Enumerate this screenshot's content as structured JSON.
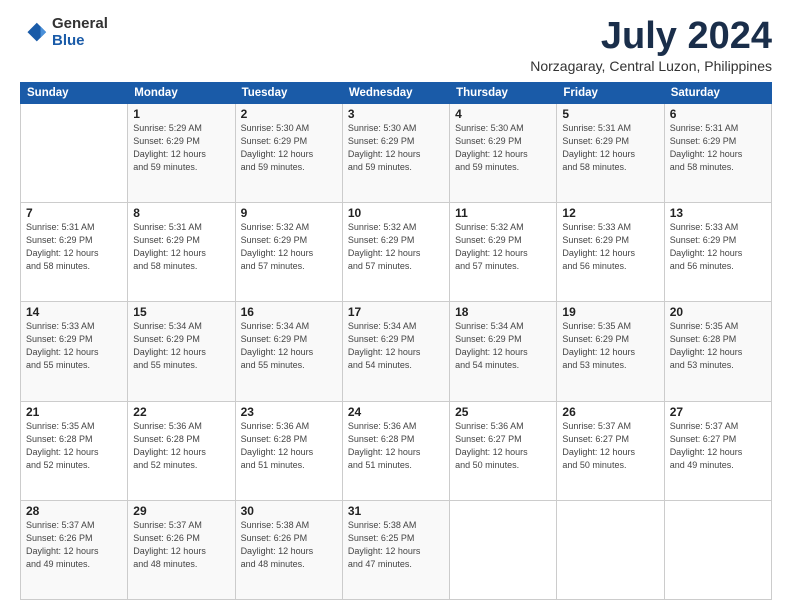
{
  "logo": {
    "general": "General",
    "blue": "Blue"
  },
  "title": "July 2024",
  "location": "Norzagaray, Central Luzon, Philippines",
  "headers": [
    "Sunday",
    "Monday",
    "Tuesday",
    "Wednesday",
    "Thursday",
    "Friday",
    "Saturday"
  ],
  "weeks": [
    [
      {
        "day": "",
        "info": ""
      },
      {
        "day": "1",
        "info": "Sunrise: 5:29 AM\nSunset: 6:29 PM\nDaylight: 12 hours\nand 59 minutes."
      },
      {
        "day": "2",
        "info": "Sunrise: 5:30 AM\nSunset: 6:29 PM\nDaylight: 12 hours\nand 59 minutes."
      },
      {
        "day": "3",
        "info": "Sunrise: 5:30 AM\nSunset: 6:29 PM\nDaylight: 12 hours\nand 59 minutes."
      },
      {
        "day": "4",
        "info": "Sunrise: 5:30 AM\nSunset: 6:29 PM\nDaylight: 12 hours\nand 59 minutes."
      },
      {
        "day": "5",
        "info": "Sunrise: 5:31 AM\nSunset: 6:29 PM\nDaylight: 12 hours\nand 58 minutes."
      },
      {
        "day": "6",
        "info": "Sunrise: 5:31 AM\nSunset: 6:29 PM\nDaylight: 12 hours\nand 58 minutes."
      }
    ],
    [
      {
        "day": "7",
        "info": "Sunrise: 5:31 AM\nSunset: 6:29 PM\nDaylight: 12 hours\nand 58 minutes."
      },
      {
        "day": "8",
        "info": "Sunrise: 5:31 AM\nSunset: 6:29 PM\nDaylight: 12 hours\nand 58 minutes."
      },
      {
        "day": "9",
        "info": "Sunrise: 5:32 AM\nSunset: 6:29 PM\nDaylight: 12 hours\nand 57 minutes."
      },
      {
        "day": "10",
        "info": "Sunrise: 5:32 AM\nSunset: 6:29 PM\nDaylight: 12 hours\nand 57 minutes."
      },
      {
        "day": "11",
        "info": "Sunrise: 5:32 AM\nSunset: 6:29 PM\nDaylight: 12 hours\nand 57 minutes."
      },
      {
        "day": "12",
        "info": "Sunrise: 5:33 AM\nSunset: 6:29 PM\nDaylight: 12 hours\nand 56 minutes."
      },
      {
        "day": "13",
        "info": "Sunrise: 5:33 AM\nSunset: 6:29 PM\nDaylight: 12 hours\nand 56 minutes."
      }
    ],
    [
      {
        "day": "14",
        "info": "Sunrise: 5:33 AM\nSunset: 6:29 PM\nDaylight: 12 hours\nand 55 minutes."
      },
      {
        "day": "15",
        "info": "Sunrise: 5:34 AM\nSunset: 6:29 PM\nDaylight: 12 hours\nand 55 minutes."
      },
      {
        "day": "16",
        "info": "Sunrise: 5:34 AM\nSunset: 6:29 PM\nDaylight: 12 hours\nand 55 minutes."
      },
      {
        "day": "17",
        "info": "Sunrise: 5:34 AM\nSunset: 6:29 PM\nDaylight: 12 hours\nand 54 minutes."
      },
      {
        "day": "18",
        "info": "Sunrise: 5:34 AM\nSunset: 6:29 PM\nDaylight: 12 hours\nand 54 minutes."
      },
      {
        "day": "19",
        "info": "Sunrise: 5:35 AM\nSunset: 6:29 PM\nDaylight: 12 hours\nand 53 minutes."
      },
      {
        "day": "20",
        "info": "Sunrise: 5:35 AM\nSunset: 6:28 PM\nDaylight: 12 hours\nand 53 minutes."
      }
    ],
    [
      {
        "day": "21",
        "info": "Sunrise: 5:35 AM\nSunset: 6:28 PM\nDaylight: 12 hours\nand 52 minutes."
      },
      {
        "day": "22",
        "info": "Sunrise: 5:36 AM\nSunset: 6:28 PM\nDaylight: 12 hours\nand 52 minutes."
      },
      {
        "day": "23",
        "info": "Sunrise: 5:36 AM\nSunset: 6:28 PM\nDaylight: 12 hours\nand 51 minutes."
      },
      {
        "day": "24",
        "info": "Sunrise: 5:36 AM\nSunset: 6:28 PM\nDaylight: 12 hours\nand 51 minutes."
      },
      {
        "day": "25",
        "info": "Sunrise: 5:36 AM\nSunset: 6:27 PM\nDaylight: 12 hours\nand 50 minutes."
      },
      {
        "day": "26",
        "info": "Sunrise: 5:37 AM\nSunset: 6:27 PM\nDaylight: 12 hours\nand 50 minutes."
      },
      {
        "day": "27",
        "info": "Sunrise: 5:37 AM\nSunset: 6:27 PM\nDaylight: 12 hours\nand 49 minutes."
      }
    ],
    [
      {
        "day": "28",
        "info": "Sunrise: 5:37 AM\nSunset: 6:26 PM\nDaylight: 12 hours\nand 49 minutes."
      },
      {
        "day": "29",
        "info": "Sunrise: 5:37 AM\nSunset: 6:26 PM\nDaylight: 12 hours\nand 48 minutes."
      },
      {
        "day": "30",
        "info": "Sunrise: 5:38 AM\nSunset: 6:26 PM\nDaylight: 12 hours\nand 48 minutes."
      },
      {
        "day": "31",
        "info": "Sunrise: 5:38 AM\nSunset: 6:25 PM\nDaylight: 12 hours\nand 47 minutes."
      },
      {
        "day": "",
        "info": ""
      },
      {
        "day": "",
        "info": ""
      },
      {
        "day": "",
        "info": ""
      }
    ]
  ]
}
